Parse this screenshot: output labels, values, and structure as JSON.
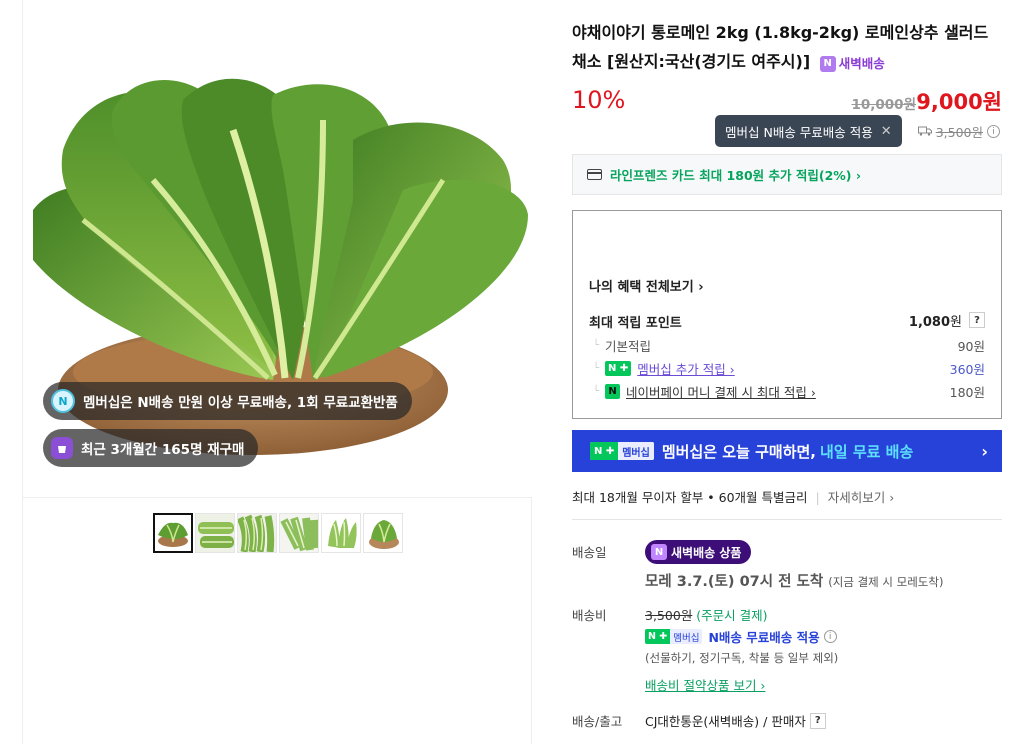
{
  "gallery": {
    "pill_membership": "멤버십은 N배송 만원 이상 무료배송, 1회 무료교환반품",
    "pill_repurchase": "최근 3개월간 165명 재구매",
    "pill_membership_icon": "N",
    "thumbnail_count": 6
  },
  "product": {
    "title": "야채이야기 통로메인 2kg (1.8kg-2kg) 로메인상추 샐러드채소 [원산지:국산(경기도 여주시)]",
    "dawn_label": "새벽배송",
    "discount": "10%",
    "original_price": "10,000원",
    "sale_price": "9,000원",
    "tooltip": "멤버십 N배송 무료배송 적용",
    "tooltip_close": "✕",
    "ship_fee_struck": "3,500원"
  },
  "card_promo": "라인프렌즈 카드 최대 180원 추가 적립(2%) ›",
  "benefits": {
    "all_link": "나의 혜택 전체보기 ›",
    "max_label": "최대 적립 포인트",
    "max_value": "1,080",
    "max_unit": "원",
    "rows": [
      {
        "label": "기본적립",
        "value": "90원"
      },
      {
        "label": "멤버십 추가 적립 ›",
        "value": "360원"
      },
      {
        "label": "네이버페이 머니 결제 시 최대 적립 ›",
        "value": "180원"
      }
    ]
  },
  "member_banner": {
    "badge_n": "N ✚",
    "badge_text": "멤버십",
    "text": "멤버십은 오늘 구매하면,",
    "highlight": "내일 무료 배송",
    "chevron": "›"
  },
  "installment": {
    "text": "최대 18개월 무이자 할부 • 60개월 특별금리",
    "detail": "자세히보기 ›"
  },
  "delivery": {
    "label": "배송일",
    "pill": "새벽배송 상품",
    "eta": "모레 3.7.(토) 07시 전 도착",
    "eta_note": "(지금 결제 시 모레도착)"
  },
  "shipping_fee": {
    "label": "배송비",
    "struck": "3,500원",
    "note": "(주문시 결제)",
    "badge_n": "N ✚",
    "badge_text": "멤버십",
    "free_text": "N배송 무료배송 적용",
    "exclusion": "(선물하기, 정기구독, 착불 등 일부 제외)",
    "saving_link": "배송비 절약상품 보기 ›"
  },
  "carrier": {
    "label": "배송/출고",
    "value": "CJ대한통운(새벽배송) / 판매자"
  },
  "colors": {
    "price_red": "#e0161e",
    "banner_blue": "#2742d8",
    "naver_green": "#03c75a",
    "dawn_purple": "#3d0e78"
  }
}
